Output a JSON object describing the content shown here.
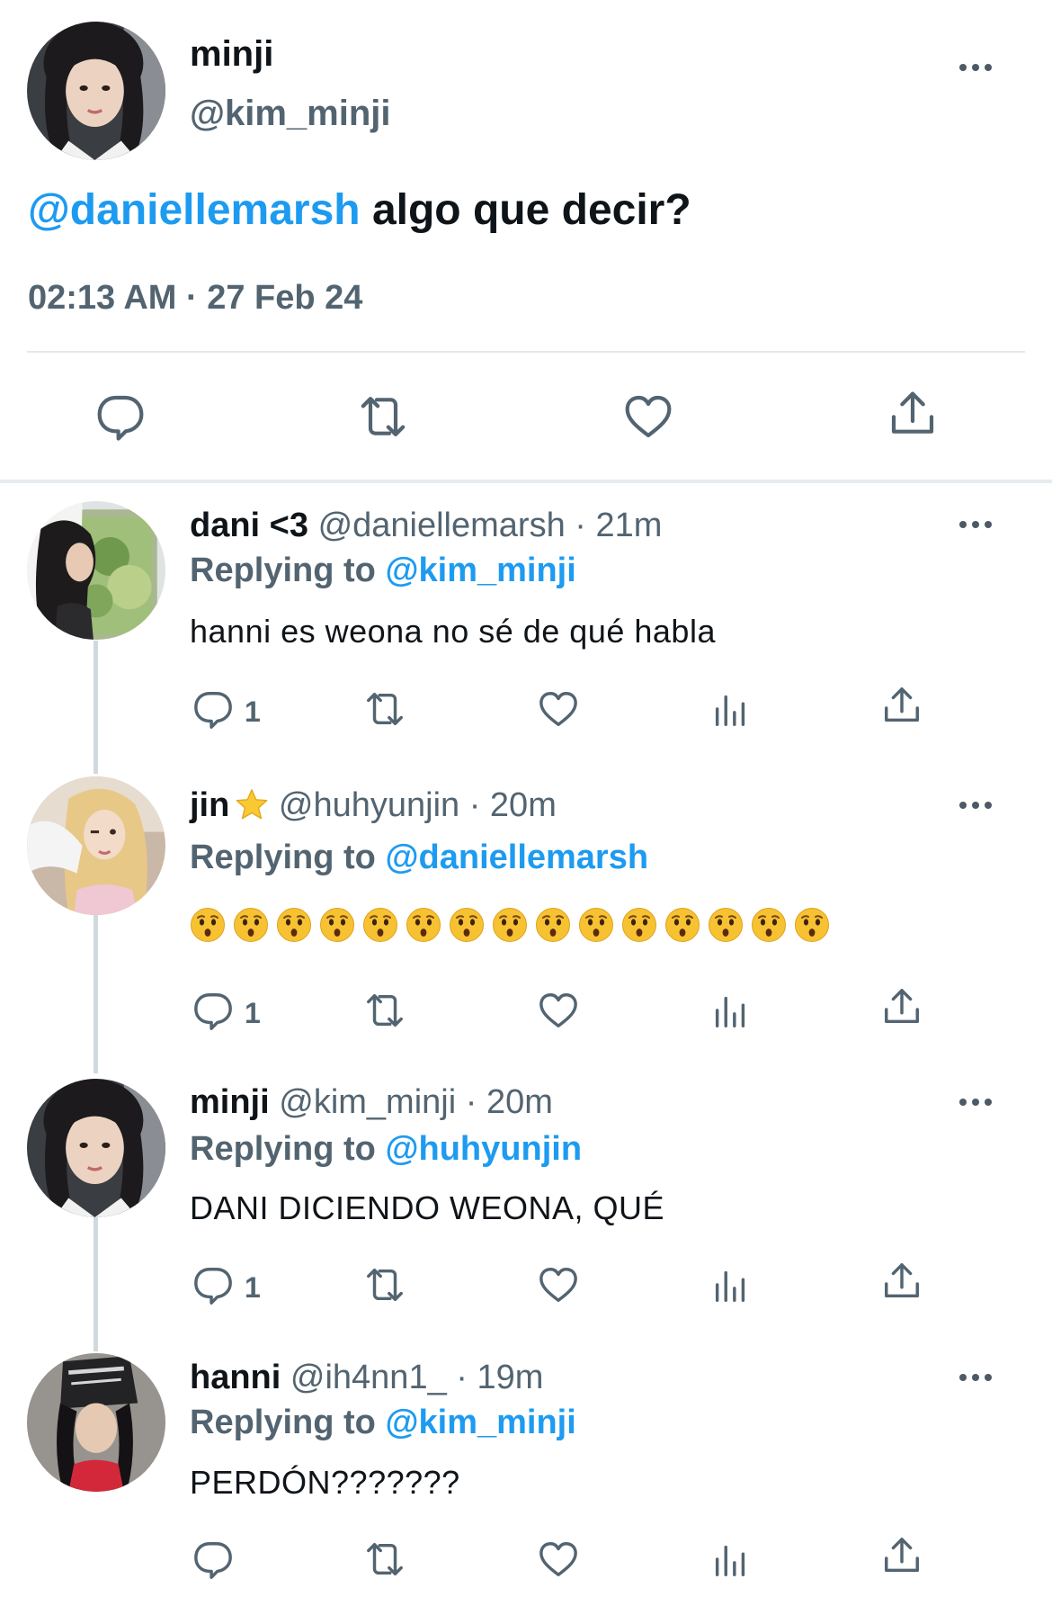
{
  "main_tweet": {
    "name": "minji",
    "handle": "@kim_minji",
    "mention": "@daniellemarsh",
    "text": " algo que decir?",
    "timestamp": "02:13 AM · 27 Feb 24"
  },
  "replies": [
    {
      "name": "dani <3",
      "handle": "@daniellemarsh · 21m",
      "replying_prefix": "Replying to ",
      "replying_to": "@kim_minji",
      "text": "hanni es weona no sé de qué habla",
      "reply_count": "1"
    },
    {
      "name": "jin",
      "name_emoji": "star",
      "handle": "@huhyunjin · 20m",
      "replying_prefix": "Replying to ",
      "replying_to": "@daniellemarsh",
      "emoji": "hushed-face",
      "emoji_count": 15,
      "reply_count": "1"
    },
    {
      "name": "minji",
      "handle": "@kim_minji · 20m",
      "replying_prefix": "Replying to ",
      "replying_to": "@huhyunjin",
      "text": "DANI DICIENDO WEONA, QUÉ",
      "reply_count": "1"
    },
    {
      "name": "hanni",
      "handle": "@ih4nn1_ · 19m",
      "replying_prefix": "Replying to ",
      "replying_to": "@kim_minji",
      "text": "PERDÓN???????",
      "reply_count": ""
    }
  ],
  "icons": [
    "more-icon",
    "reply-icon",
    "retweet-icon",
    "like-icon",
    "share-icon",
    "views-icon"
  ],
  "colors": {
    "accent": "#1d9bf0",
    "secondary_text": "#536471",
    "text": "#0f1419",
    "thread_line": "#cfd9de"
  }
}
